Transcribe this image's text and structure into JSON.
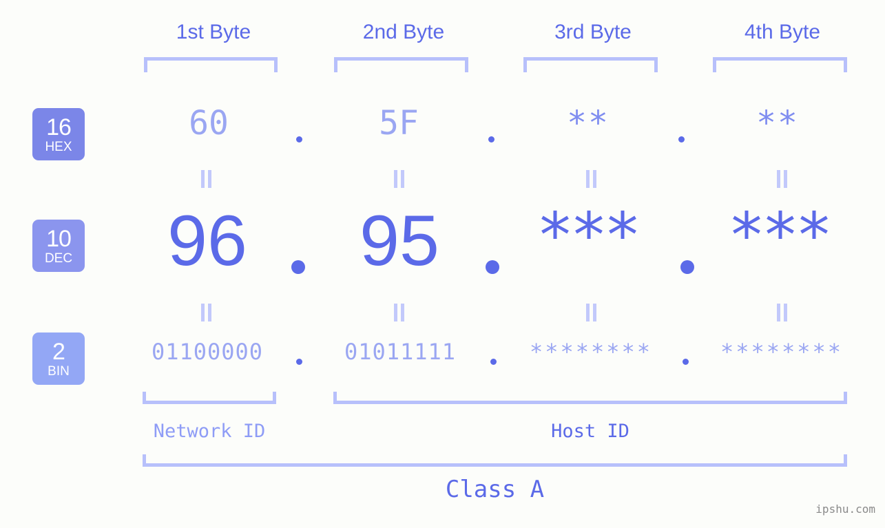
{
  "background_color": "#fcfdfa",
  "accent_color": "#5b6ae8",
  "light_accent_color": "#b7c0fb",
  "byte_headers": [
    {
      "label": "1st Byte"
    },
    {
      "label": "2nd Byte"
    },
    {
      "label": "3rd Byte"
    },
    {
      "label": "4th Byte"
    }
  ],
  "bases": [
    {
      "id": "hex",
      "number": "16",
      "name": "HEX",
      "color": "#7b86e8"
    },
    {
      "id": "dec",
      "number": "10",
      "name": "DEC",
      "color": "#8b95ee"
    },
    {
      "id": "bin",
      "number": "2",
      "name": "BIN",
      "color": "#93a7f5"
    }
  ],
  "rows": {
    "hex": {
      "values": [
        "60",
        "5F",
        "**",
        "**"
      ],
      "separator": "."
    },
    "dec": {
      "values": [
        "96",
        "95",
        "***",
        "***"
      ],
      "separator": "."
    },
    "bin": {
      "values": [
        "01100000",
        "01011111",
        "********",
        "********"
      ],
      "separator": "."
    }
  },
  "equality_marks": {
    "glyph": "=",
    "count_per_row": 4,
    "rows": 2
  },
  "sections": {
    "network_id": "Network ID",
    "host_id": "Host ID",
    "class": "Class A"
  },
  "watermark": "ipshu.com"
}
